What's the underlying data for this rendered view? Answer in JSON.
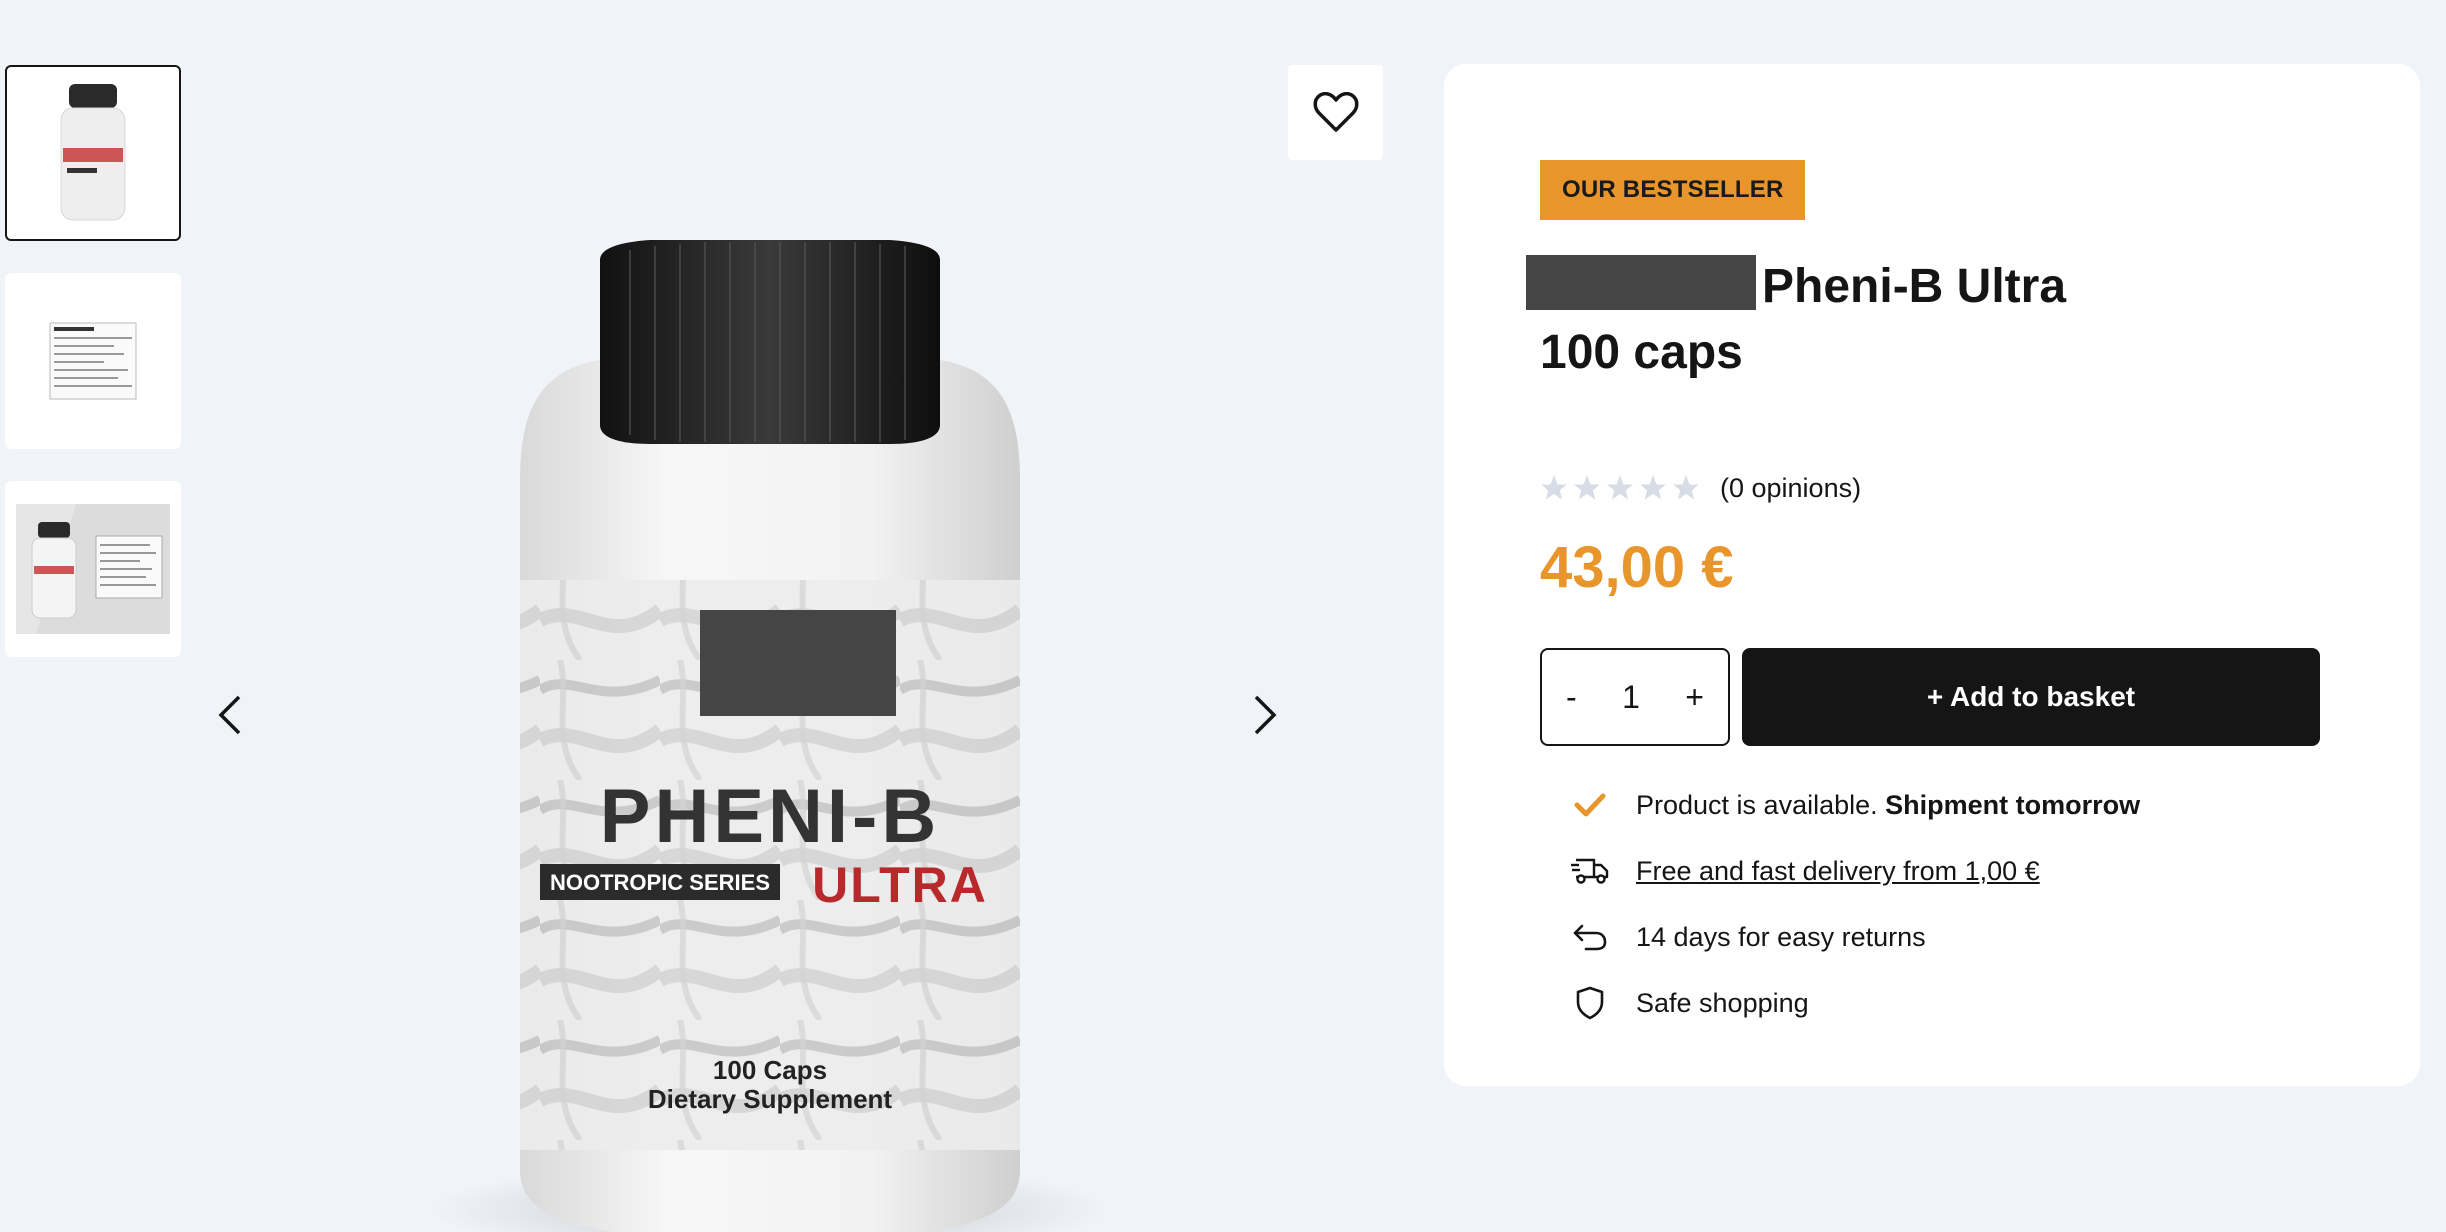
{
  "gallery": {
    "thumbnails": [
      {
        "label": "product-front-view"
      },
      {
        "label": "supplement-facts"
      },
      {
        "label": "product-and-label"
      }
    ],
    "bottle": {
      "brand_line1": "PHENI-B",
      "series": "NOOTROPIC SERIES",
      "variant": "ULTRA",
      "caps": "100 Caps",
      "type": "Dietary Supplement"
    }
  },
  "product": {
    "badge": "OUR BESTSELLER",
    "title_line1": "Pheni-B Ultra",
    "title_line2": "100 caps",
    "rating": 0,
    "rating_max": 5,
    "opinions": "(0 opinions)",
    "price": "43,00 €",
    "quantity": "1",
    "qty_minus": "-",
    "qty_plus": "+",
    "add_to_basket": "+ Add to basket"
  },
  "features": {
    "availability_prefix": "Product is available.",
    "availability_bold": "Shipment tomorrow",
    "delivery": "Free and fast delivery from 1,00 €",
    "returns": "14 days for easy returns",
    "safe": "Safe shopping"
  },
  "colors": {
    "accent": "#e8952c",
    "dark": "#151515",
    "background": "#f0f4f9",
    "star_empty": "#d6dde6"
  }
}
